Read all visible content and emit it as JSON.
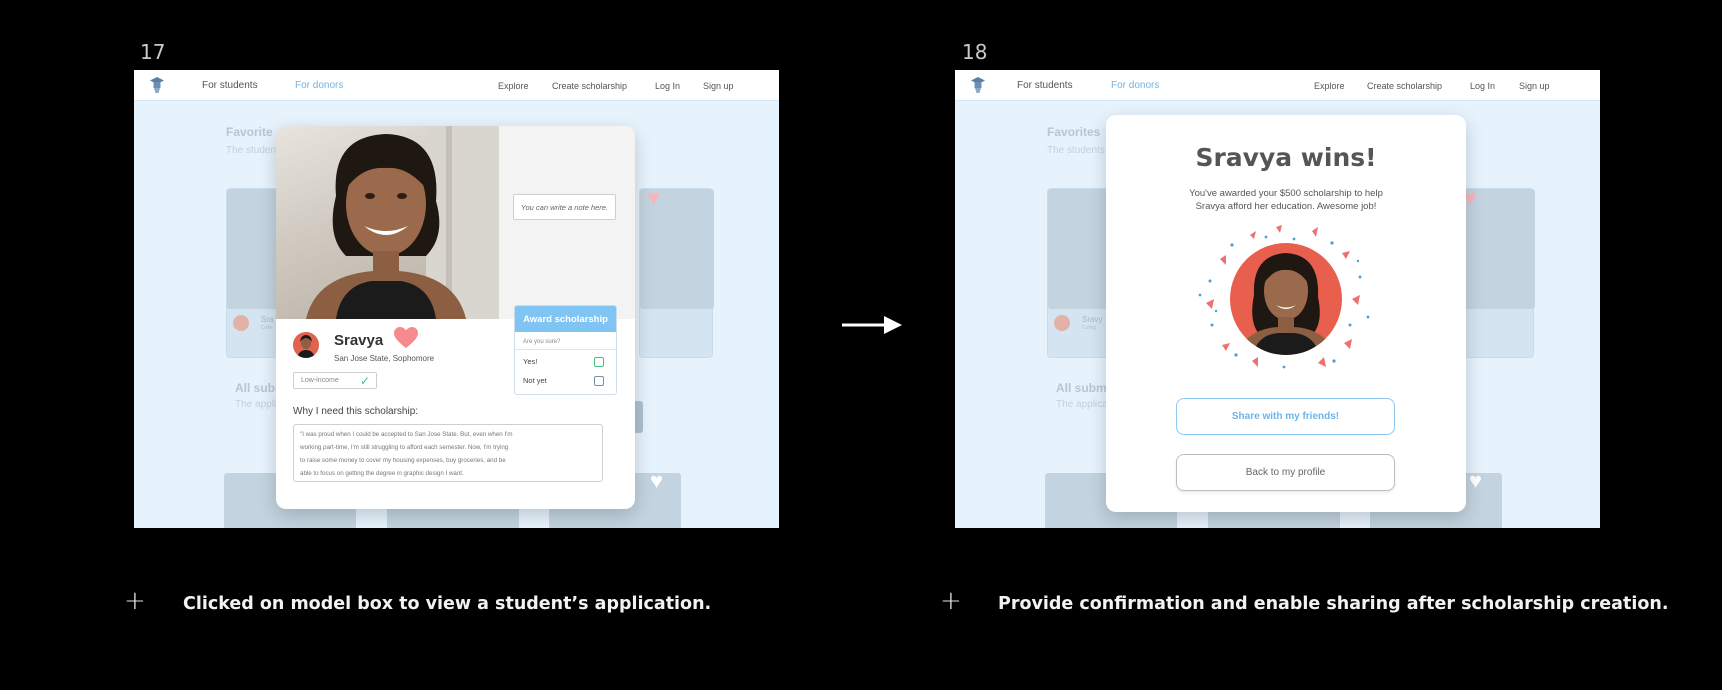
{
  "frames": [
    {
      "number": "17",
      "caption": "Clicked on model box to view a student’s application.",
      "nav": {
        "for_students": "For students",
        "for_donors": "For donors",
        "explore": "Explore",
        "create_scholarship": "Create scholarship",
        "log_in": "Log In",
        "sign_up": "Sign up"
      },
      "background": {
        "favorites_title": "Favorite",
        "favorites_sub": "The studen",
        "all_title": "All subm",
        "all_sub": "The applic",
        "card_name": "Sra",
        "card_school": "Colle"
      },
      "modal": {
        "note_placeholder": "You can write a note here.",
        "student_name": "Sravya",
        "student_school": "San Jose State, Sophomore",
        "tag": "Low-income",
        "award_button": "Award scholarship",
        "award_question": "Are you sure?",
        "option_yes": "Yes!",
        "option_no": "Not yet",
        "why_title": "Why I need this scholarship:",
        "essay_lines": [
          "\"I was proud when I could be accepted to San Jose State.  But, even when I'm",
          "working part-time, I'm still struggling to afford each semester.   Now, I'm trying",
          "to raise some money to cover my housing expenses, buy groceries, and be",
          "able to focus on getting the degree in graphic design I want."
        ]
      }
    },
    {
      "number": "18",
      "caption": "Provide confirmation and enable sharing after scholarship creation.",
      "nav": {
        "for_students": "For students",
        "for_donors": "For donors",
        "explore": "Explore",
        "create_scholarship": "Create scholarship",
        "log_in": "Log In",
        "sign_up": "Sign up"
      },
      "background": {
        "favorites_title": "Favorites",
        "favorites_sub": "The students",
        "all_title": "All subm",
        "all_sub": "The applica",
        "card_name": "Sravy",
        "card_school": "Colleg"
      },
      "modal": {
        "title": "Sravya wins!",
        "subtitle_line1": "You've awarded your $500 scholarship to help",
        "subtitle_line2": "Sravya afford her education.  Awesome job!",
        "share_button": "Share with my friends!",
        "back_button": "Back to my profile"
      }
    }
  ],
  "colors": {
    "accent_blue": "#7fc4f2",
    "heart_pink": "#f58a8f",
    "confetti_red": "#f07070",
    "confetti_blue": "#4a9fe0",
    "page_bg": "#e6f2fc"
  },
  "icons": [
    "graduation-cap-logo-icon",
    "heart-icon",
    "checkmark-icon",
    "arrow-right-icon",
    "plus-icon"
  ]
}
